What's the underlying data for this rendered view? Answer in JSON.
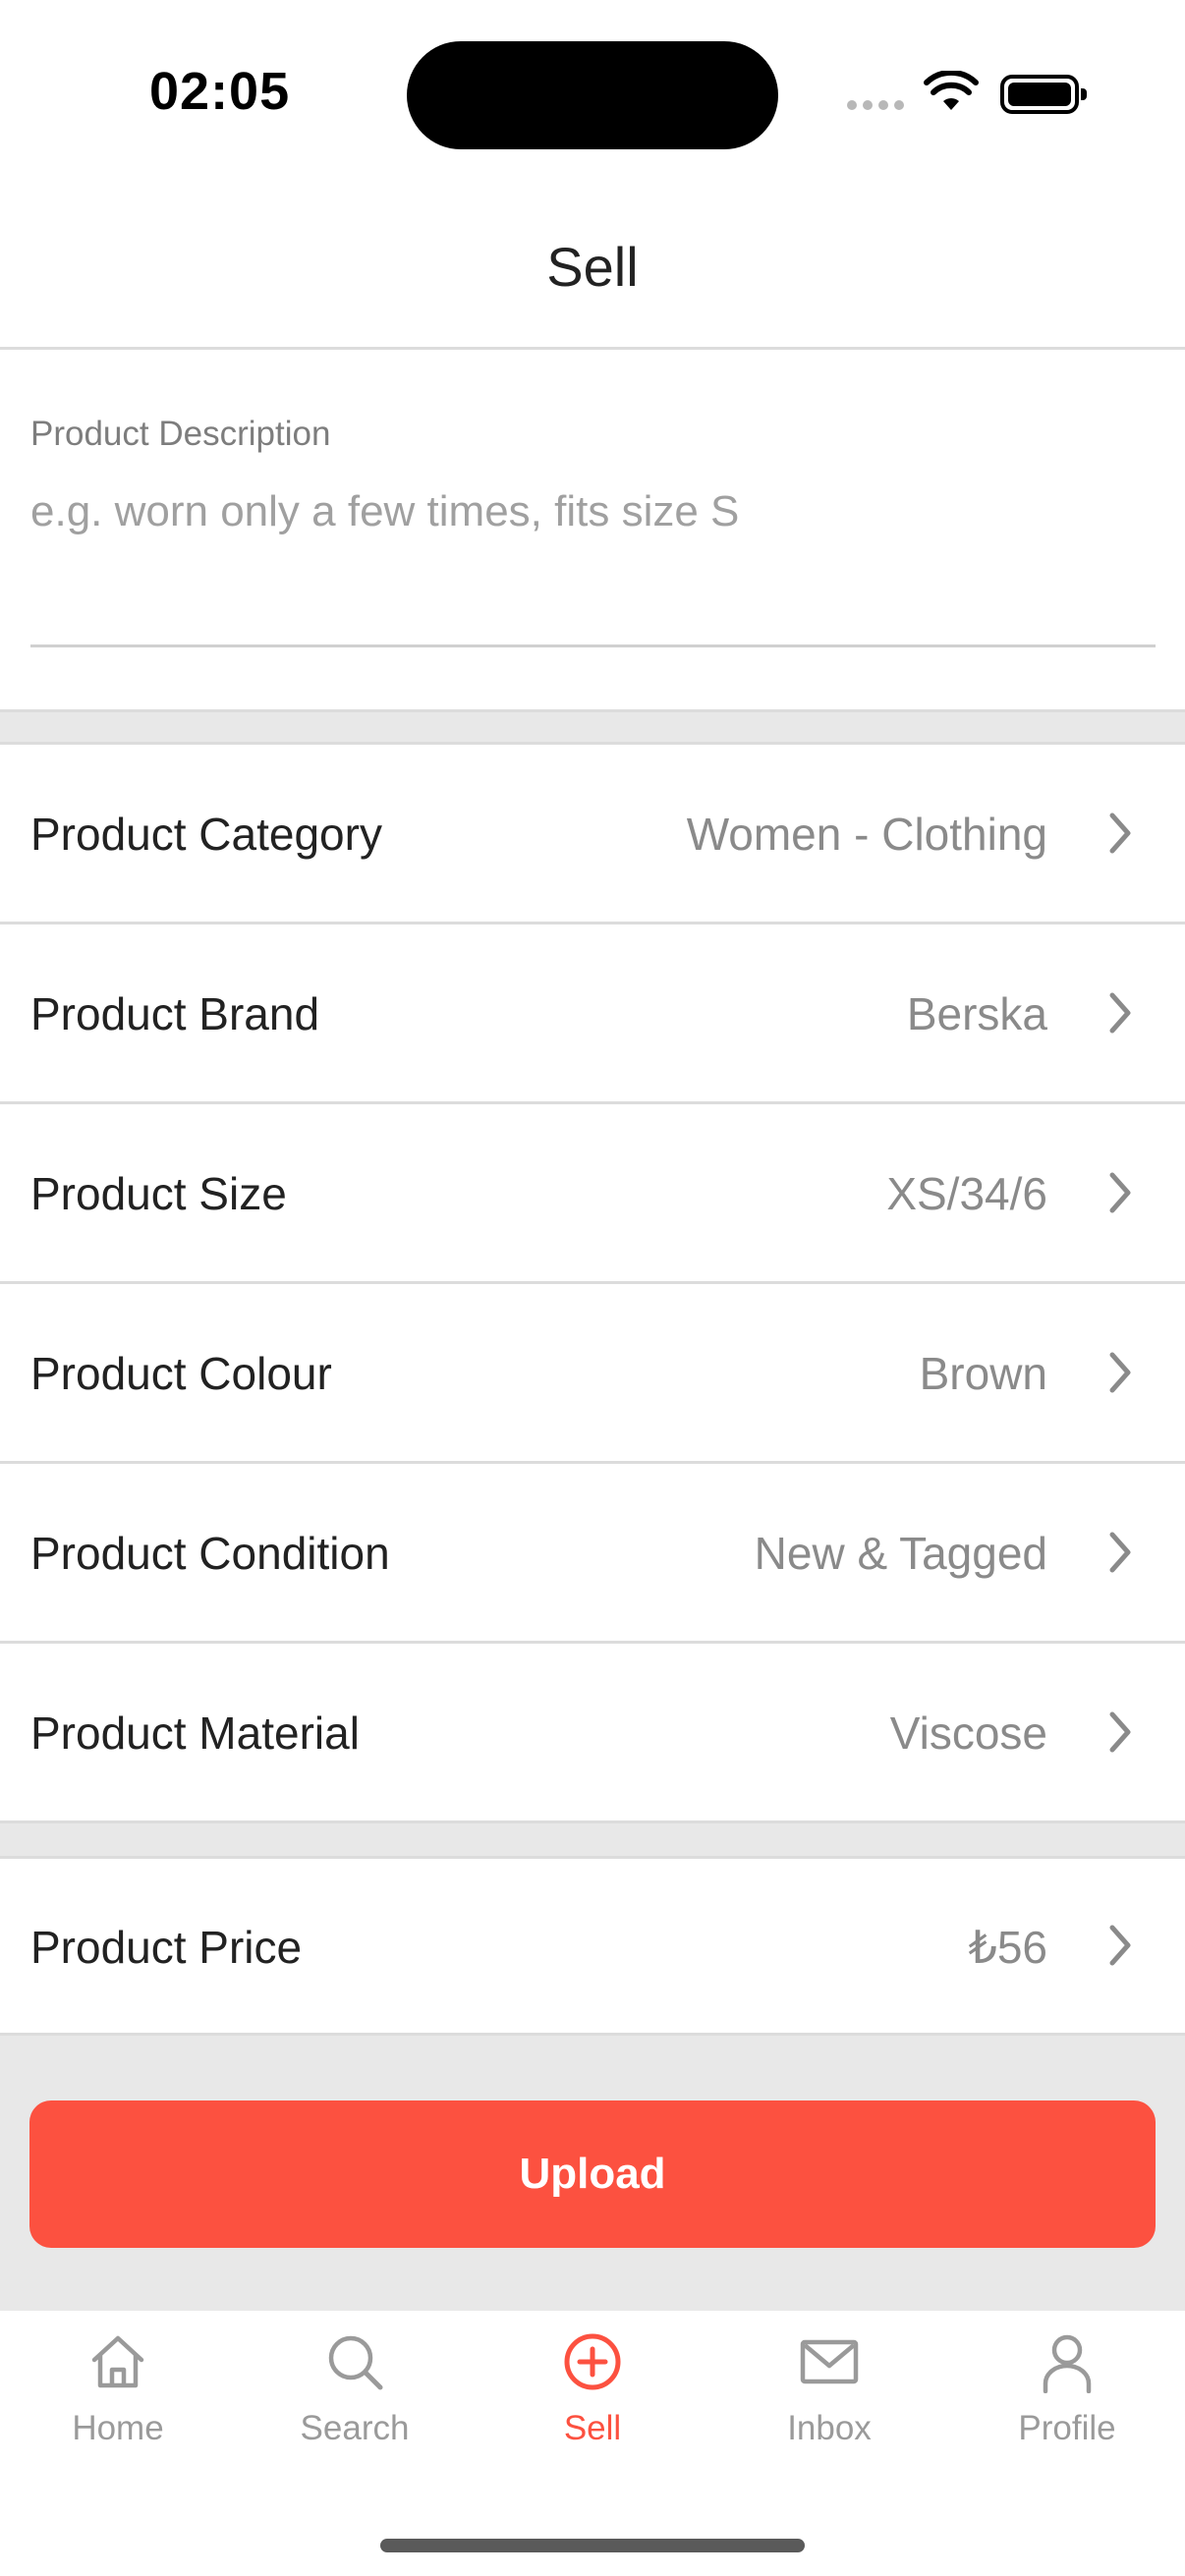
{
  "status_bar": {
    "time": "02:05"
  },
  "header": {
    "title": "Sell"
  },
  "description": {
    "label": "Product Description",
    "placeholder": "e.g. worn only a few times, fits size S",
    "value": ""
  },
  "rows": [
    {
      "label": "Product Category",
      "value": "Women - Clothing"
    },
    {
      "label": "Product Brand",
      "value": "Berska"
    },
    {
      "label": "Product Size",
      "value": "XS/34/6"
    },
    {
      "label": "Product Colour",
      "value": "Brown"
    },
    {
      "label": "Product Condition",
      "value": "New & Tagged"
    },
    {
      "label": "Product Material",
      "value": "Viscose"
    }
  ],
  "price": {
    "label": "Product Price",
    "value": "₺56"
  },
  "upload": {
    "label": "Upload"
  },
  "tabs": [
    {
      "label": "Home",
      "icon": "home-icon"
    },
    {
      "label": "Search",
      "icon": "search-icon"
    },
    {
      "label": "Sell",
      "icon": "plus-circle-icon"
    },
    {
      "label": "Inbox",
      "icon": "mail-icon"
    },
    {
      "label": "Profile",
      "icon": "user-icon"
    }
  ],
  "active_tab": "Sell",
  "colors": {
    "accent": "#fc5140",
    "separator": "#dcdcdc",
    "section_gap": "#e8e8e8",
    "value_text": "#8a8a8a"
  }
}
